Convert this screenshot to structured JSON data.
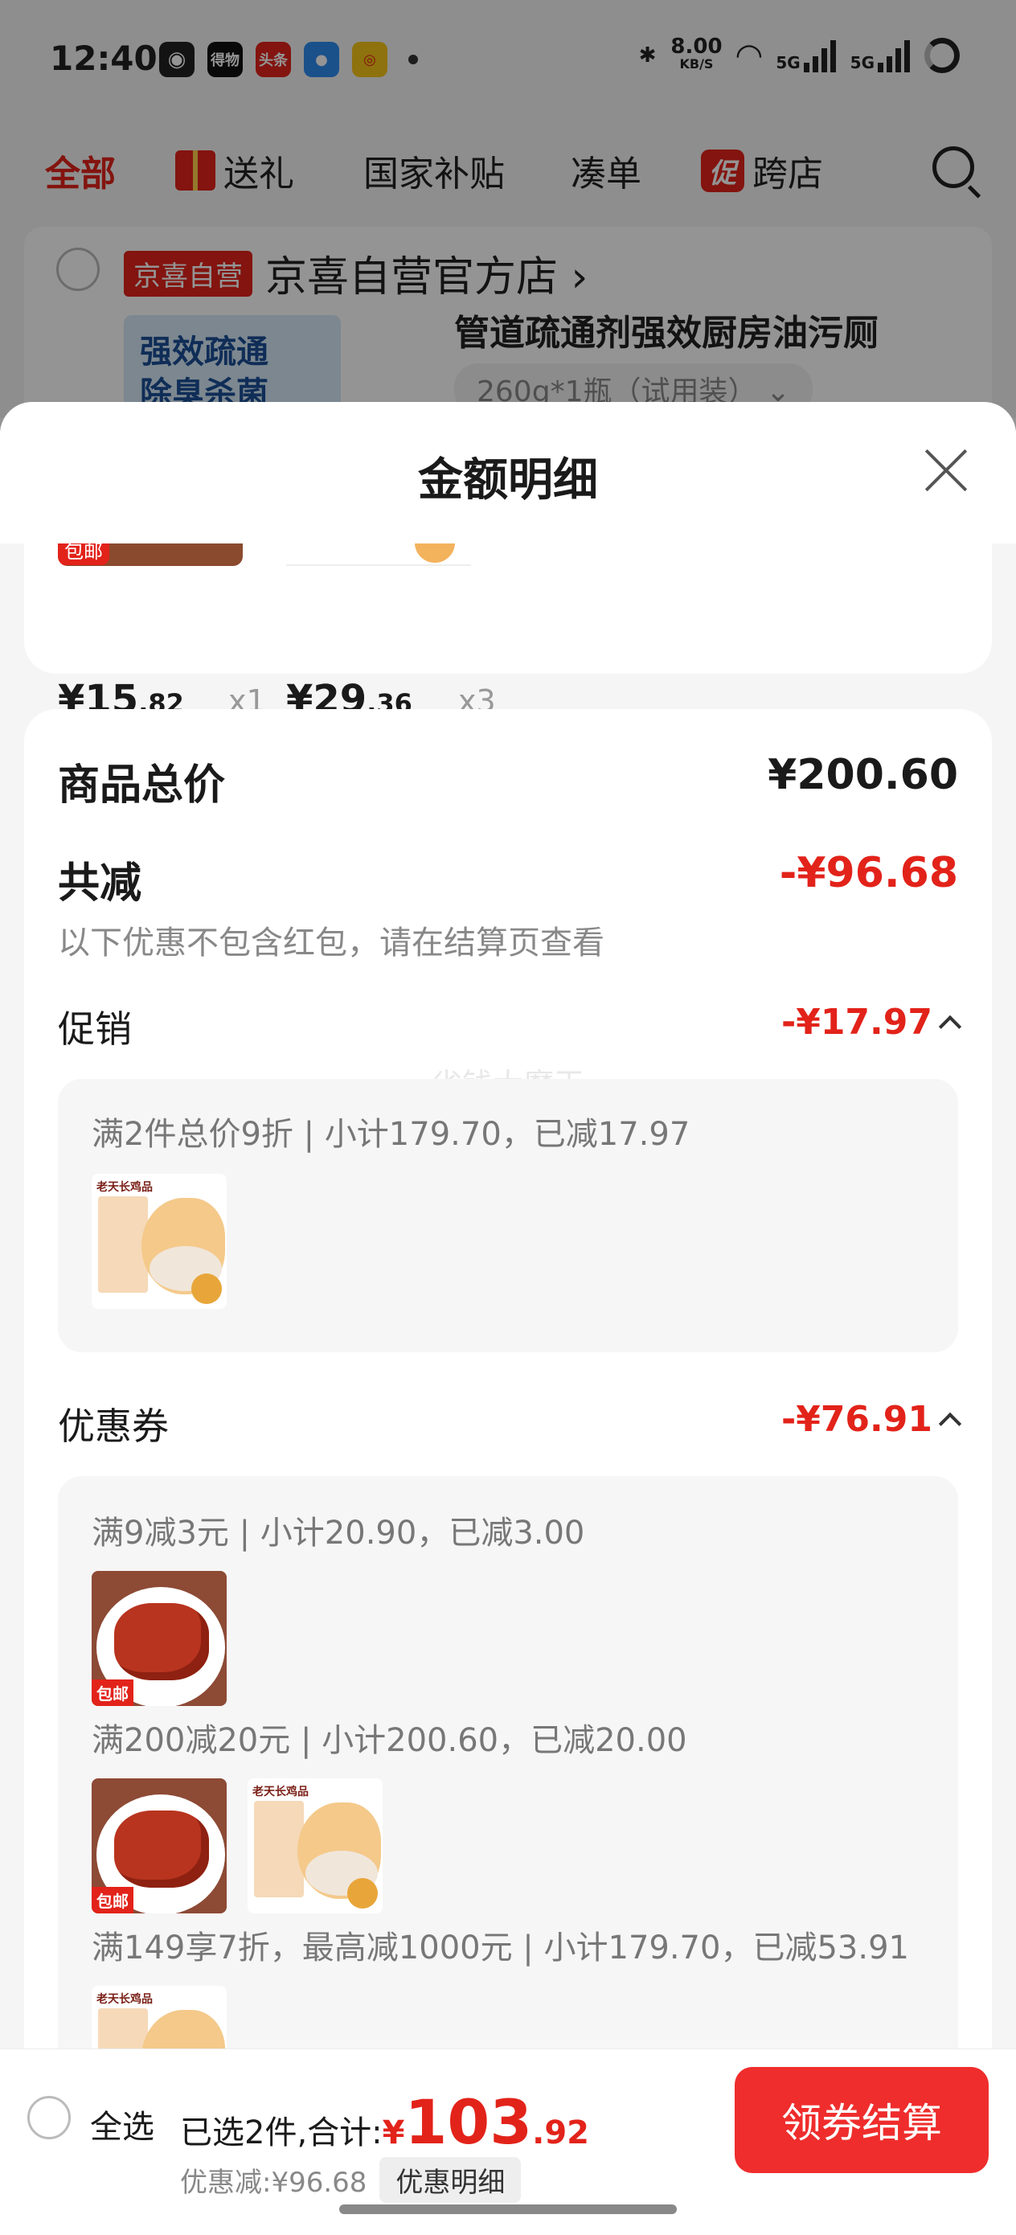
{
  "status_bar": {
    "time": "12:40",
    "apps": [
      "wechat-icon",
      "dewu-icon",
      "toutiao-icon",
      "qq-icon",
      "weibo-icon"
    ],
    "app_labels": [
      "",
      "得物",
      "头条",
      "",
      ""
    ],
    "net_speed": "8.00",
    "net_unit": "KB/S",
    "signal_labels": [
      "5G",
      "5G"
    ]
  },
  "top_tabs": {
    "items": [
      "全部",
      "送礼",
      "国家补贴",
      "凑单",
      "跨店"
    ],
    "active_index": 0,
    "promo_badge": "促"
  },
  "store": {
    "badge": "京喜自营",
    "name": "京喜自营官方店 ›",
    "product_thumb_text": "强效疏通\n除臭杀菌",
    "product_title": "管道疏通剂强效厨房油污厕",
    "product_spec": "260g*1瓶（试用装） ⌄"
  },
  "sheet": {
    "title": "金额明细",
    "items": [
      {
        "tag": "包邮",
        "price_int": "¥15",
        "price_dec": ".82",
        "qty": "x1"
      },
      {
        "tag": "",
        "price_int": "¥29",
        "price_dec": ".36",
        "qty": "x3"
      }
    ],
    "total_label": "商品总价",
    "total_value": "¥200.60",
    "reduce_label": "共减",
    "reduce_value": "-¥96.68",
    "reduce_hint": "以下优惠不包含红包，请在结算页查看",
    "watermark": "省钱大魔王",
    "promo": {
      "label": "促销",
      "value": "-¥17.97",
      "line": "满2件总价9折 | 小计179.70，已减17.97"
    },
    "coupon": {
      "label": "优惠券",
      "value": "-¥76.91",
      "lines": [
        "满9减3元 | 小计20.90，已减3.00",
        "满200减20元 | 小计200.60，已减20.00",
        "满149享7折，最高减1000元 | 小计179.70，已减53.91"
      ]
    },
    "thumb_labels": {
      "chicken_brand": "老天长鸡品",
      "ribs_tag": "包邮"
    }
  },
  "bottom_bar": {
    "select_all": "全选",
    "summary_prefix": "已选2件,合计:",
    "currency": "¥",
    "total_int": "103",
    "total_dec": ".92",
    "discount_text": "优惠减:¥96.68",
    "detail_chip": "优惠明细",
    "checkout": "领券结算"
  },
  "colors": {
    "accent": "#e2231a",
    "checkout": "#ef2d2d",
    "overlay": "rgba(0,0,0,0.42)"
  }
}
